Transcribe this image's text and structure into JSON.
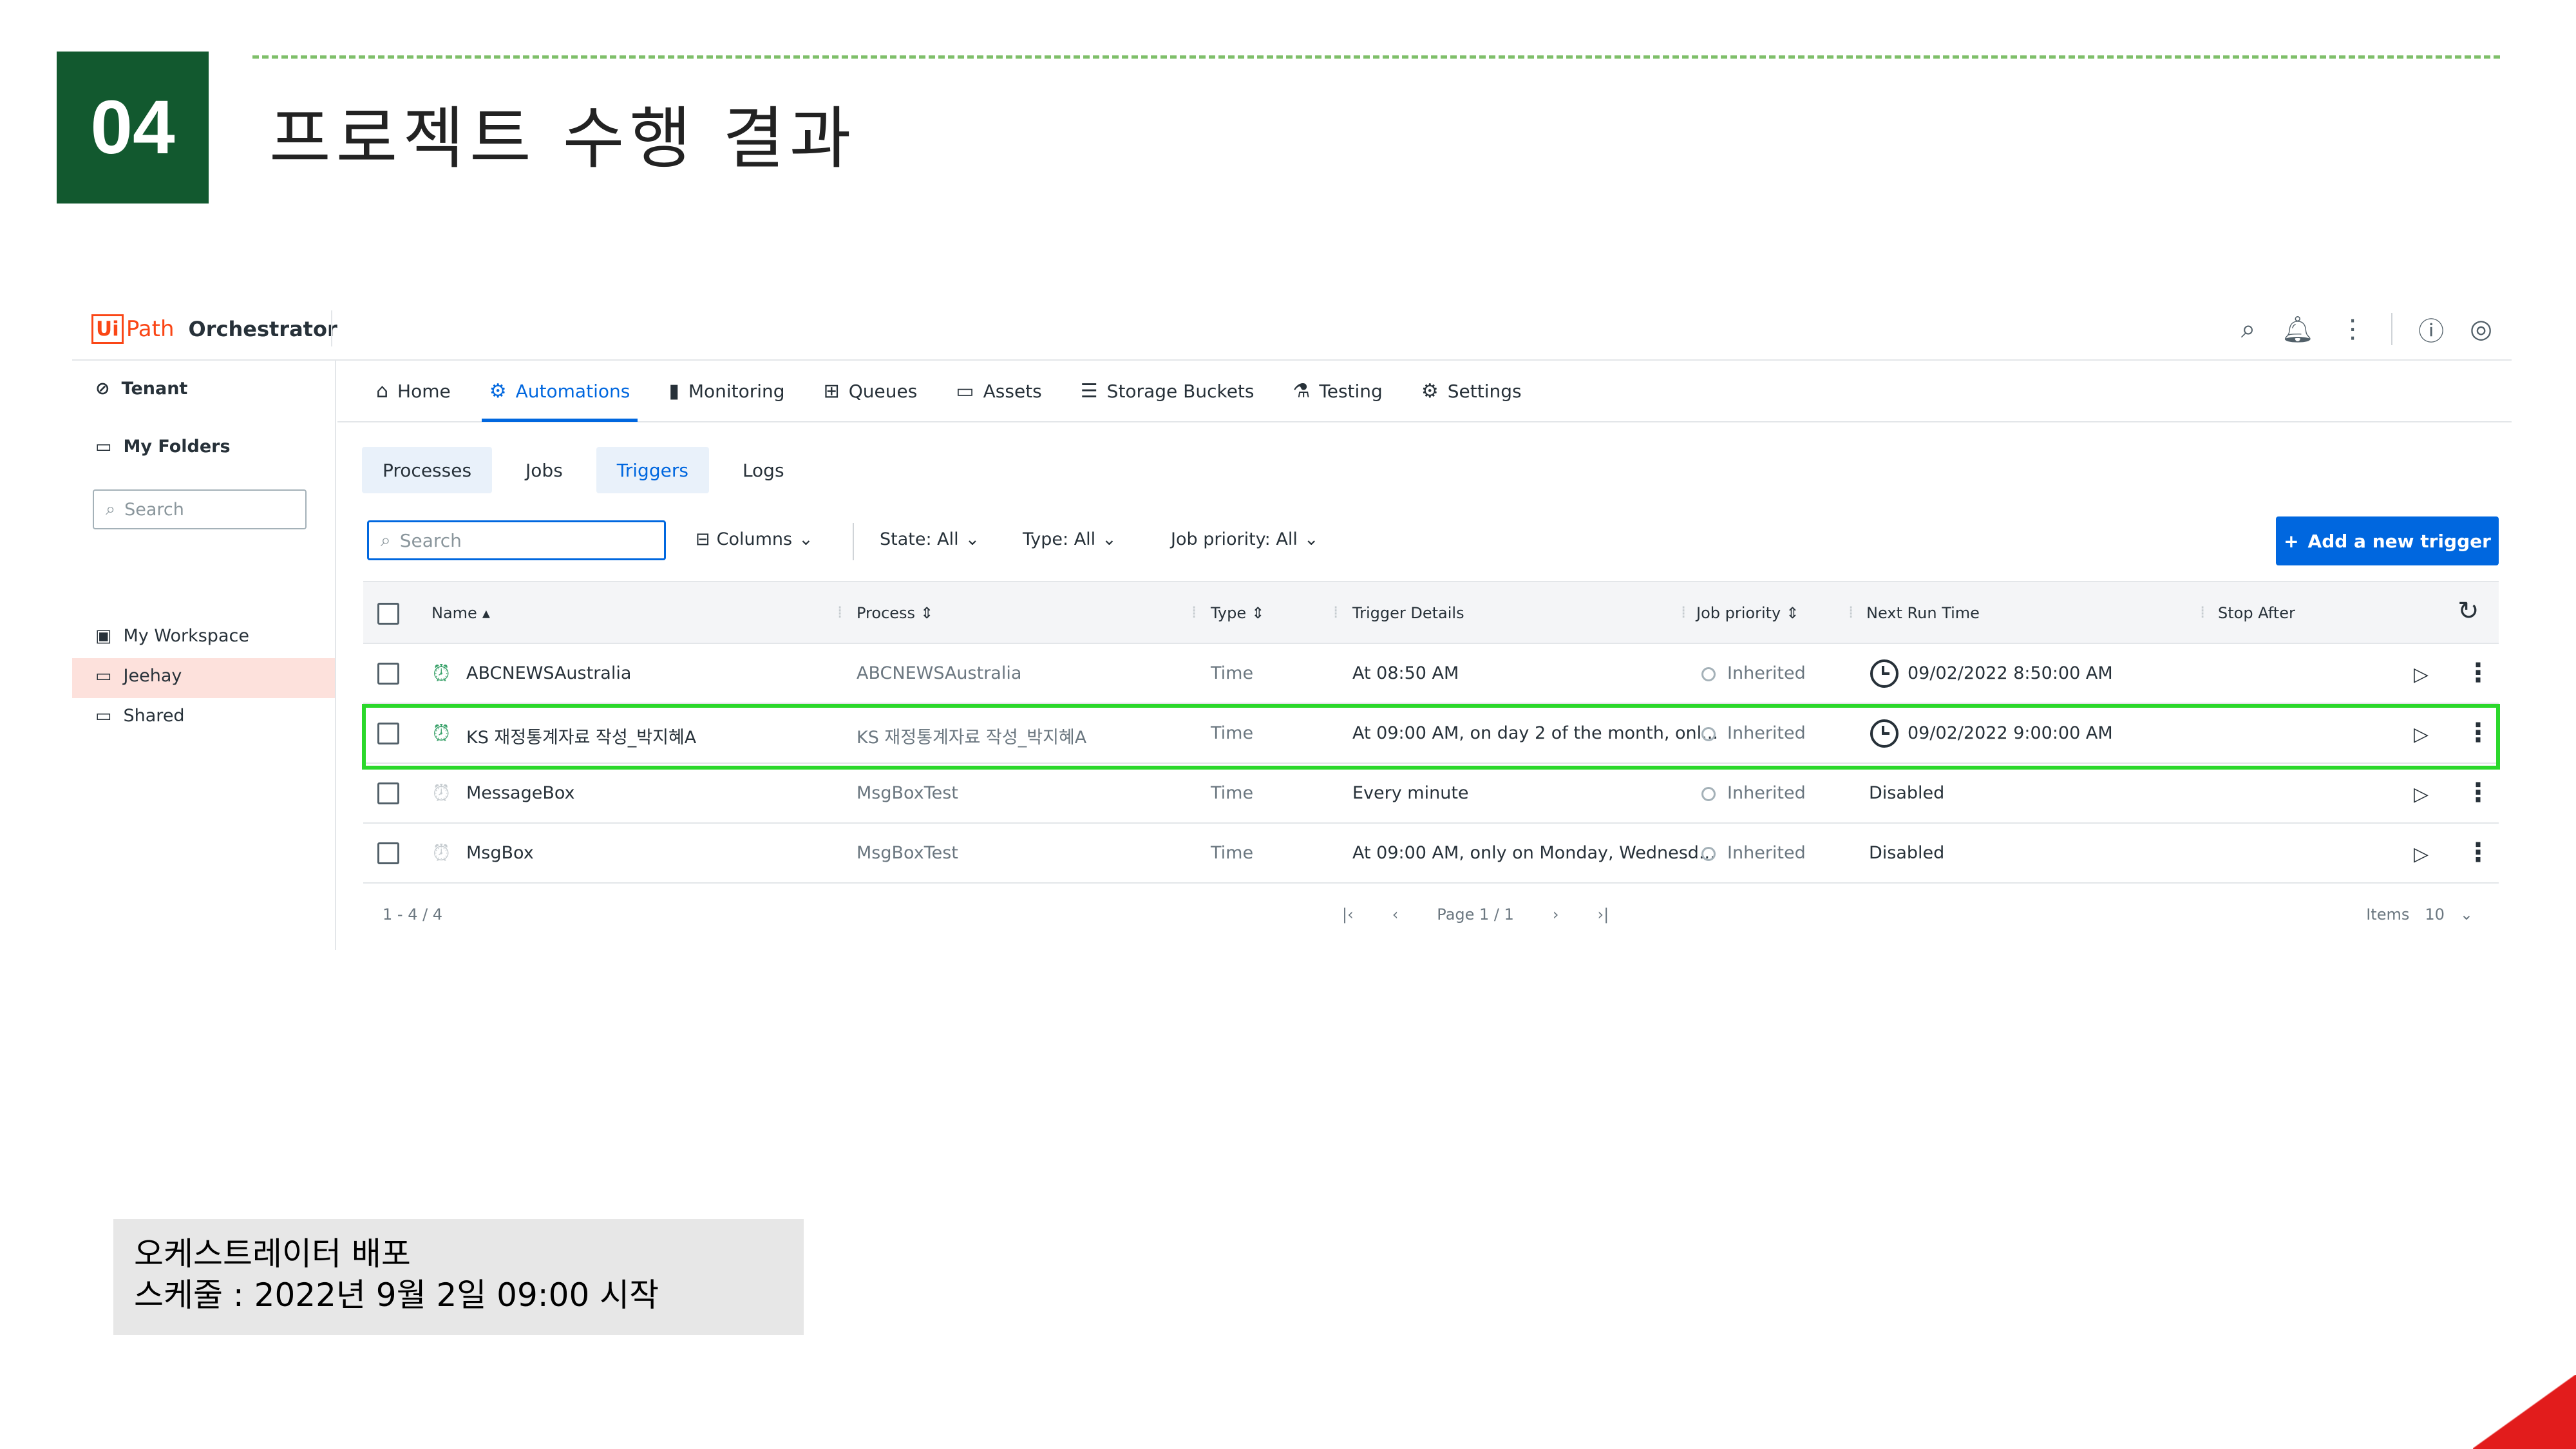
{
  "slide": {
    "number": "04",
    "title": "프로젝트 수행 결과",
    "caption_line1": "오케스트레이터 배포",
    "caption_line2": "스케줄 : 2022년 9월 2일 09:00 시작"
  },
  "app": {
    "logo_ui": "Ui",
    "logo_path": "Path",
    "product": "Orchestrator"
  },
  "sidebar": {
    "tenant": "Tenant",
    "my_folders": "My Folders",
    "search_placeholder": "Search",
    "items": [
      {
        "label": "My Workspace",
        "icon": "workspace-icon"
      },
      {
        "label": "Jeehay",
        "icon": "folder-icon",
        "active": true
      },
      {
        "label": "Shared",
        "icon": "folder-icon"
      }
    ]
  },
  "nav": {
    "tabs": [
      {
        "label": "Home",
        "icon": "home-icon"
      },
      {
        "label": "Automations",
        "icon": "automations-icon",
        "active": true
      },
      {
        "label": "Monitoring",
        "icon": "monitoring-icon"
      },
      {
        "label": "Queues",
        "icon": "queues-icon"
      },
      {
        "label": "Assets",
        "icon": "assets-icon"
      },
      {
        "label": "Storage Buckets",
        "icon": "storage-icon"
      },
      {
        "label": "Testing",
        "icon": "flask-icon"
      },
      {
        "label": "Settings",
        "icon": "gear-icon"
      }
    ]
  },
  "subtabs": [
    "Processes",
    "Jobs",
    "Triggers",
    "Logs"
  ],
  "toolbar": {
    "search_placeholder": "Search",
    "columns": "Columns",
    "state": "State: All",
    "type": "Type: All",
    "priority": "Job priority: All",
    "add_button": "Add a new trigger"
  },
  "table": {
    "headers": {
      "name": "Name",
      "process": "Process",
      "type": "Type",
      "details": "Trigger Details",
      "priority": "Job priority",
      "next_run": "Next Run Time",
      "stop_after": "Stop After"
    },
    "rows": [
      {
        "name": "ABCNEWSAustralia",
        "process": "ABCNEWSAustralia",
        "type": "Time",
        "details": "At 08:50 AM",
        "priority": "Inherited",
        "next_run": "09/02/2022 8:50:00 AM",
        "enabled": true
      },
      {
        "name": "KS 재정통계자료 작성_박지혜A",
        "process": "KS 재정통계자료 작성_박지혜A",
        "type": "Time",
        "details": "At 09:00 AM, on day 2 of the month, onl...",
        "priority": "Inherited",
        "next_run": "09/02/2022 9:00:00 AM",
        "enabled": true,
        "highlighted": true
      },
      {
        "name": "MessageBox",
        "process": "MsgBoxTest",
        "type": "Time",
        "details": "Every minute",
        "priority": "Inherited",
        "next_run": "Disabled",
        "enabled": false
      },
      {
        "name": "MsgBox",
        "process": "MsgBoxTest",
        "type": "Time",
        "details": "At 09:00 AM, only on Monday, Wednesd...",
        "priority": "Inherited",
        "next_run": "Disabled",
        "enabled": false
      }
    ]
  },
  "pager": {
    "range": "1 - 4 / 4",
    "page": "Page 1 / 1",
    "items_label": "Items",
    "items_value": "10"
  },
  "colors": {
    "slide_green": "#12592f",
    "accent_blue": "#0067df",
    "uipath_orange": "#fa4616",
    "highlight_green": "#2bd82b"
  }
}
